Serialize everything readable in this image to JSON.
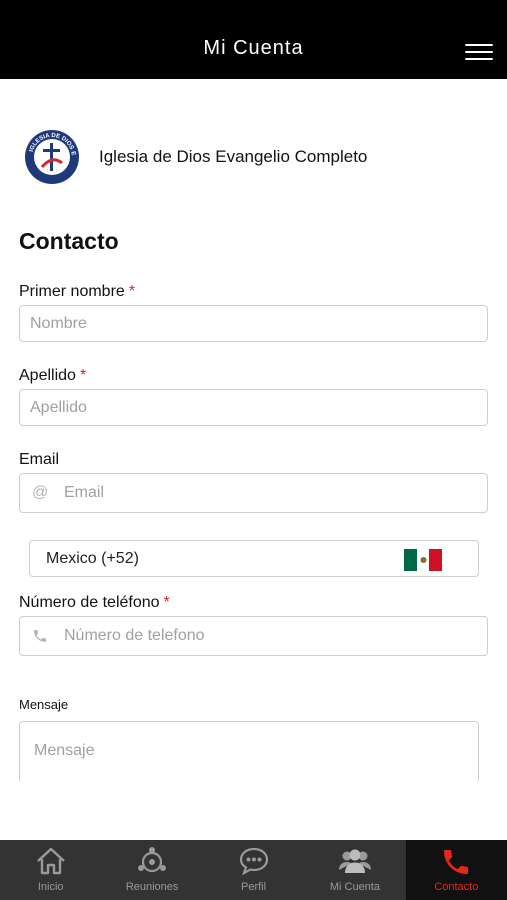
{
  "header": {
    "title": "Mi Cuenta"
  },
  "church": {
    "name": "Iglesia de Dios Evangelio Completo",
    "logo_text": "IGLESIA DE DIOS EC"
  },
  "form": {
    "title": "Contacto",
    "required_mark": "*",
    "first_name": {
      "label": "Primer nombre",
      "placeholder": "Nombre",
      "value": ""
    },
    "last_name": {
      "label": "Apellido",
      "placeholder": "Apellido",
      "value": ""
    },
    "email": {
      "label": "Email",
      "placeholder": "Email",
      "icon_glyph": "@",
      "icon": "at-icon",
      "value": ""
    },
    "country": {
      "value": "Mexico (+52)",
      "flag": "mexico-flag"
    },
    "phone": {
      "label": "Número de teléfono",
      "placeholder": "Número de telefono",
      "icon": "phone-icon",
      "value": ""
    },
    "message": {
      "label": "Mensaje",
      "placeholder": "Mensaje",
      "value": ""
    }
  },
  "tabs": [
    {
      "label": "Inicio",
      "icon": "home-icon",
      "active": false
    },
    {
      "label": "Reuniones",
      "icon": "people-circle-icon",
      "active": false
    },
    {
      "label": "Perfil",
      "icon": "chat-bubble-icon",
      "active": false
    },
    {
      "label": "Mi Cuenta",
      "icon": "group-icon",
      "active": false
    },
    {
      "label": "Contacto",
      "icon": "phone-icon",
      "active": true
    }
  ],
  "colors": {
    "header_bg": "#000000",
    "tabbar_bg": "#333333",
    "active_tab_bg": "#111111",
    "accent_red": "#e8251c",
    "required_red": "#d9262c",
    "logo_blue": "#1f3a7a",
    "flag_green": "#006847",
    "flag_white": "#ffffff",
    "flag_red": "#ce1126"
  }
}
